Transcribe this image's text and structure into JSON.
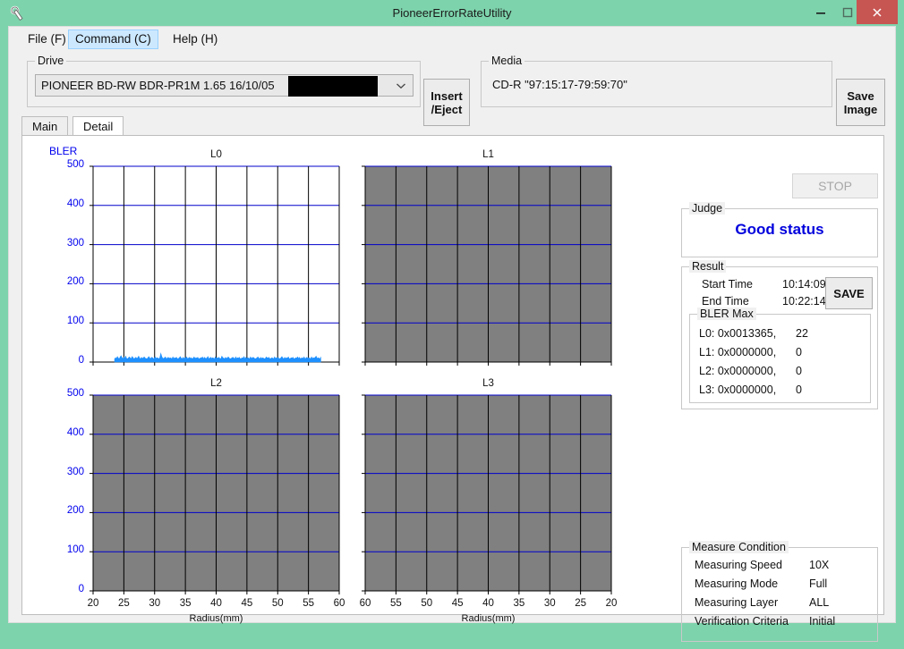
{
  "window": {
    "title": "PioneerErrorRateUtility",
    "icon": "wrench-icon",
    "minimize": "–",
    "maximize": "□",
    "close": "✕",
    "accent_titlebar": "#7dd3ac",
    "accent_close": "#c75552"
  },
  "menu": {
    "items": [
      {
        "label": "File (F)",
        "selected": false
      },
      {
        "label": "Command (C)",
        "selected": true
      },
      {
        "label": "Help (H)",
        "selected": false
      }
    ]
  },
  "drive": {
    "group_label": "Drive",
    "value": "PIONEER BD-RW BDR-PR1M  1.65 16/10/05",
    "redacted": true,
    "dropdown_icon": "chevron-down-icon"
  },
  "insert_eject": {
    "line1": "Insert",
    "line2": "/Eject"
  },
  "media": {
    "group_label": "Media",
    "value": "CD-R \"97:15:17-79:59:70\""
  },
  "save_image": {
    "line1": "Save",
    "line2": "Image"
  },
  "tabs": [
    {
      "label": "Main",
      "selected": false
    },
    {
      "label": "Detail",
      "selected": true
    }
  ],
  "stop_button": {
    "label": "STOP",
    "enabled": false
  },
  "judge": {
    "group_label": "Judge",
    "status": "Good status",
    "color": "#0000dd"
  },
  "result": {
    "group_label": "Result",
    "start_time_label": "Start Time",
    "start_time_value": "10:14:09",
    "end_time_label": "End Time",
    "end_time_value": "10:22:14",
    "save_label": "SAVE",
    "bler_max_label": "BLER Max",
    "bler_rows": [
      {
        "label": "L0: 0x0013365,",
        "value": "22"
      },
      {
        "label": "L1: 0x0000000,",
        "value": "0"
      },
      {
        "label": "L2: 0x0000000,",
        "value": "0"
      },
      {
        "label": "L3: 0x0000000,",
        "value": "0"
      }
    ]
  },
  "measure_condition": {
    "group_label": "Measure Condition",
    "rows": [
      {
        "label": "Measuring Speed",
        "value": "10X"
      },
      {
        "label": "Measuring Mode",
        "value": "Full"
      },
      {
        "label": "Measuring Layer",
        "value": "ALL"
      },
      {
        "label": "Verification Criteria",
        "value": "Initial"
      }
    ]
  },
  "chart_data": [
    {
      "type": "area",
      "id": "L0",
      "title": "L0",
      "ylabel": "BLER",
      "xlabel": "Radius(mm)",
      "yticks": [
        500,
        400,
        300,
        200,
        100,
        0
      ],
      "ylim": [
        0,
        500
      ],
      "xticks": [
        20,
        25,
        30,
        35,
        40,
        45,
        50,
        55,
        60
      ],
      "xlim": [
        20,
        60
      ],
      "x_reversed": false,
      "grid": true,
      "grid_color": "#0000cc",
      "enabled": true,
      "disabled_fill": null,
      "series_color": "#1e90ff",
      "data_x_start": 23.5,
      "data_x_end": 57.0,
      "series": [
        {
          "name": "BLER",
          "values": [
            8,
            11,
            9,
            14,
            10,
            8,
            13,
            16,
            11,
            9,
            12,
            10,
            15,
            9,
            8,
            11,
            13,
            10,
            9,
            14,
            11,
            8,
            10,
            12,
            9,
            11,
            15,
            10,
            8,
            12,
            9,
            11,
            13,
            10,
            9,
            8,
            11,
            14,
            10,
            9,
            12,
            11,
            8,
            10,
            13,
            9,
            11,
            10,
            8,
            12,
            22,
            14,
            10,
            9,
            11,
            13,
            8,
            10,
            12,
            9,
            11,
            10,
            8,
            13,
            9,
            11,
            10,
            12,
            8,
            9,
            11,
            14,
            10,
            8,
            12,
            9,
            11,
            10,
            13,
            8,
            10,
            12,
            9,
            11,
            8,
            10,
            13,
            9,
            11,
            10,
            12,
            8,
            9,
            11,
            10,
            13,
            8,
            12,
            10,
            9,
            11,
            14,
            8,
            10,
            12,
            9,
            11,
            10,
            8,
            13,
            9,
            11,
            10,
            12,
            8,
            9,
            15,
            11,
            10,
            8,
            12,
            9,
            11,
            13,
            10,
            8,
            9,
            11,
            12,
            10,
            8,
            13,
            9,
            11,
            10,
            12,
            8,
            9,
            11,
            10,
            14,
            8,
            12,
            9,
            11,
            10,
            8,
            13,
            9,
            11,
            12,
            10,
            8,
            9,
            11,
            13,
            10,
            8,
            12,
            9,
            11,
            10,
            8,
            9,
            13,
            11,
            10,
            12,
            8,
            9,
            11,
            10,
            8,
            13,
            9,
            11,
            10,
            12,
            8,
            9,
            11,
            14,
            10,
            8,
            12,
            9,
            11,
            10,
            13,
            8,
            9,
            11,
            10,
            12,
            8,
            9,
            11,
            10,
            13,
            9,
            12,
            8,
            10,
            11,
            9,
            13,
            8,
            10,
            12,
            9,
            11,
            10,
            8,
            13,
            9,
            11,
            10,
            12,
            15,
            9,
            11,
            10,
            8,
            12
          ]
        }
      ]
    },
    {
      "type": "area",
      "id": "L1",
      "title": "L1",
      "ylabel": "BLER",
      "xlabel": "Radius(mm)",
      "yticks": [
        500,
        400,
        300,
        200,
        100,
        0
      ],
      "ylim": [
        0,
        500
      ],
      "xticks": [
        60,
        55,
        50,
        45,
        40,
        35,
        30,
        25,
        20
      ],
      "xlim": [
        60,
        20
      ],
      "x_reversed": true,
      "grid": true,
      "grid_color": "#0000cc",
      "enabled": false,
      "disabled_fill": "#808080",
      "series": []
    },
    {
      "type": "area",
      "id": "L2",
      "title": "L2",
      "ylabel": "BLER",
      "xlabel": "Radius(mm)",
      "yticks": [
        500,
        400,
        300,
        200,
        100,
        0
      ],
      "ylim": [
        0,
        500
      ],
      "xticks": [
        20,
        25,
        30,
        35,
        40,
        45,
        50,
        55,
        60
      ],
      "xlim": [
        20,
        60
      ],
      "x_reversed": false,
      "grid": true,
      "grid_color": "#0000cc",
      "enabled": false,
      "disabled_fill": "#808080",
      "series": []
    },
    {
      "type": "area",
      "id": "L3",
      "title": "L3",
      "ylabel": "BLER",
      "xlabel": "Radius(mm)",
      "yticks": [
        500,
        400,
        300,
        200,
        100,
        0
      ],
      "ylim": [
        0,
        500
      ],
      "xticks": [
        60,
        55,
        50,
        45,
        40,
        35,
        30,
        25,
        20
      ],
      "xlim": [
        60,
        20
      ],
      "x_reversed": true,
      "grid": true,
      "grid_color": "#0000cc",
      "enabled": false,
      "disabled_fill": "#808080",
      "series": []
    }
  ]
}
